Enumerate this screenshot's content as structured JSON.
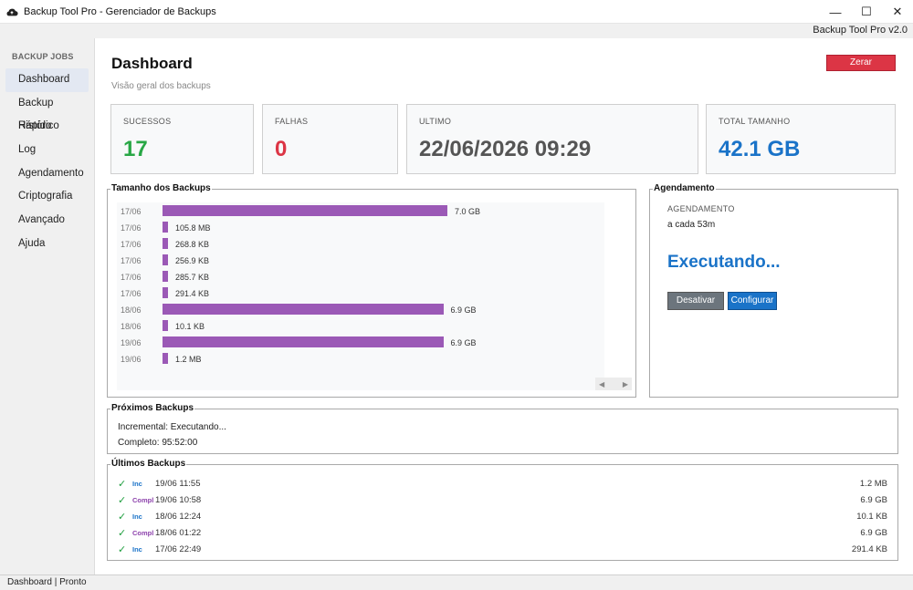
{
  "window": {
    "title": "Backup Tool Pro - Gerenciador de Backups",
    "version": "Backup Tool Pro v2.0",
    "minimize_glyph": "—",
    "maximize_glyph": "☐",
    "close_glyph": "✕"
  },
  "sidebar": {
    "heading": "BACKUP JOBS",
    "items": [
      {
        "label": "Dashboard",
        "active": true
      },
      {
        "label": "Backup Rápido"
      },
      {
        "label": "Histórico"
      },
      {
        "label": "Log"
      },
      {
        "label": "Agendamento"
      },
      {
        "label": "Criptografia"
      },
      {
        "label": "Avançado"
      },
      {
        "label": "Ajuda"
      }
    ]
  },
  "dashboard": {
    "title": "Dashboard",
    "subtitle": "Visão geral dos backups",
    "reset_button": "Zerar contadores",
    "cards": [
      {
        "label": "SUCESSOS",
        "value": "17",
        "color": "#28a745"
      },
      {
        "label": "FALHAS",
        "value": "0",
        "color": "#dc3545"
      },
      {
        "label": "ULTIMO",
        "value": "22/06/2026 09:29",
        "color": "#555555"
      },
      {
        "label": "TOTAL TAMANHO",
        "value": "42.1 GB",
        "color": "#1a73c8"
      }
    ]
  },
  "chart_panel": {
    "title": "Tamanho dos Backups",
    "scroll_left": "◀",
    "scroll_right": "▶"
  },
  "chart_data": {
    "type": "bar",
    "orientation": "horizontal",
    "color": "#9b59b6",
    "categories": [
      "17/06",
      "17/06",
      "17/06",
      "17/06",
      "17/06",
      "17/06",
      "18/06",
      "18/06",
      "19/06",
      "19/06"
    ],
    "value_labels": [
      "7.0 GB",
      "105.8 MB",
      "268.8 KB",
      "256.9 KB",
      "285.7 KB",
      "291.4 KB",
      "6.9 GB",
      "10.1 KB",
      "6.9 GB",
      "1.2 MB"
    ],
    "values_gb": [
      7.0,
      0.1058,
      0.0002688,
      0.0002569,
      0.0002857,
      0.0002914,
      6.9,
      1.01e-05,
      6.9,
      0.0012
    ]
  },
  "schedule": {
    "title": "Agendamento",
    "label": "AGENDAMENTO",
    "interval": "a cada 53m",
    "status": "Executando...",
    "disable_button": "Desativar",
    "config_button": "Configurar"
  },
  "next_backups": {
    "title": "Próximos Backups",
    "incremental": "Incremental: Executando...",
    "complete": "Completo: 95:52:00"
  },
  "last_backups": {
    "title": "Últimos Backups",
    "rows": [
      {
        "type": "Inc",
        "kind": "inc",
        "when": "19/06 11:55",
        "size": "1.2 MB"
      },
      {
        "type": "Compl",
        "kind": "comp",
        "when": "19/06 10:58",
        "size": "6.9 GB"
      },
      {
        "type": "Inc",
        "kind": "inc",
        "when": "18/06 12:24",
        "size": "10.1 KB"
      },
      {
        "type": "Compl",
        "kind": "comp",
        "when": "18/06 01:22",
        "size": "6.9 GB"
      },
      {
        "type": "Inc",
        "kind": "inc",
        "when": "17/06 22:49",
        "size": "291.4 KB"
      }
    ],
    "check_glyph": "✓"
  },
  "statusbar": {
    "text": "Dashboard | Pronto"
  }
}
